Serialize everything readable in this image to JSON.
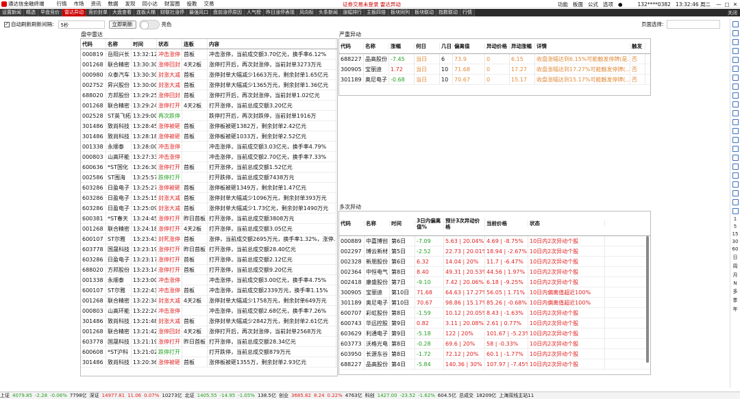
{
  "titlebar": {
    "app": "通达信金融终端",
    "menu": [
      "行情",
      "市场",
      "资讯",
      "数据",
      "发现",
      "同小达",
      "财富圈",
      "投教",
      "交易"
    ],
    "center": "证券交易未登录  雷达异动",
    "right": [
      "功能",
      "板面",
      "公式",
      "选项"
    ],
    "account": "132****0382",
    "time": "13:32:46 周二"
  },
  "tabs": [
    {
      "label": "设置新闻"
    },
    {
      "label": "精选"
    },
    {
      "label": "早盘竞价"
    },
    {
      "label": "雷达异动",
      "active": true
    },
    {
      "label": "竞价封单"
    },
    {
      "label": "大盘查看"
    },
    {
      "label": "连板天梯"
    },
    {
      "label": "财联社涨停"
    },
    {
      "label": "最强风口"
    },
    {
      "label": "盘前涨停原因"
    },
    {
      "label": "人气榜"
    },
    {
      "label": "昨日涨停表现"
    },
    {
      "label": "风向标"
    },
    {
      "label": "头条新闻"
    },
    {
      "label": "涨幅排行"
    },
    {
      "label": "主板四倍"
    },
    {
      "label": "板块同列"
    },
    {
      "label": "板块联动"
    },
    {
      "label": "指数联动"
    },
    {
      "label": "行情"
    }
  ],
  "tab_close": "关闭",
  "controls": {
    "auto_refresh_label": "自动刷新刷新间隔:",
    "interval": "5秒",
    "refresh_button": "立即刷新",
    "bright_label": "亮色",
    "page_select_label": "页面选择:"
  },
  "radar": {
    "title": "盘中雷达",
    "headers": [
      "代码",
      "名称",
      "时间",
      "状态",
      "连板",
      "内容"
    ],
    "rows": [
      [
        "000819",
        "岳阳兴长",
        "13:32:12",
        "冲击涨停",
        "首板",
        "冲击涨停，当前成交额3.70亿元，换手率6.12%"
      ],
      [
        "001268",
        "联合精密",
        "13:30:30",
        "涨停回封",
        "4天2板",
        "涨停打开后，再次封涨停，当前封单3273万元"
      ],
      [
        "000980",
        "众泰汽车",
        "13:30:30",
        "封涨大减",
        "首板",
        "涨停封单大幅减少1663万元，剩余封单1.65亿元"
      ],
      [
        "002752",
        "昇兴股份",
        "13:30:00",
        "封涨大减",
        "首板",
        "涨停封单大幅减少1365万元，剩余封单1.36亿元"
      ],
      [
        "688020",
        "方邦股份",
        "13:29:25",
        "涨停回封",
        "首板",
        "涨停打开后，再次封涨停，当前封单1.02亿元"
      ],
      [
        "001268",
        "联合精密",
        "13:29:24",
        "涨停打开",
        "4天2板",
        "打开涨停，当前总成交额3.20亿元"
      ],
      [
        "002528",
        "ST英飞拓",
        "13:29:00",
        "再次跌停",
        "",
        "跌停打开后，再次封跌停，当前封单1916万"
      ],
      [
        "301486",
        "致尚科技",
        "13:28:45",
        "涨停被砸",
        "首板",
        "涨停板被砸1382万，剩余封单2.42亿元"
      ],
      [
        "301486",
        "致尚科技",
        "13:28:18",
        "涨停被砸",
        "首板",
        "涨停板被砸1033万，剩余封单2.52亿元"
      ],
      [
        "001338",
        "永顺泰",
        "13:28:00",
        "冲击涨停",
        "",
        "冲击涨停，当前成交额3.03亿元，换手率4.79%"
      ],
      [
        "000803",
        "山高环能",
        "13:27:33",
        "冲击涨停",
        "",
        "冲击涨停，当前成交额2.70亿元，换手率7.33%"
      ],
      [
        "600636",
        "*ST国化",
        "13:26:30",
        "涨停打开",
        "首板",
        "打开涨停，当前总成交额1.52亿元"
      ],
      [
        "002586",
        "ST围海",
        "13:25:57",
        "跌停打开",
        "",
        "打开跌停，当前总成交额7438万元"
      ],
      [
        "603286",
        "日盈电子",
        "13:25:27",
        "涨停被砸",
        "首板",
        "涨停板被砸1349万，剩余封单1.47亿元"
      ],
      [
        "603286",
        "日盈电子",
        "13:25:15",
        "封涨大减",
        "首板",
        "涨停封单大幅减少1096万元，剩余封单393万元"
      ],
      [
        "603286",
        "日盈电子",
        "13:25:09",
        "封涨大减",
        "首板",
        "涨停封单大幅减少1.73亿元，剩余封单1490万元"
      ],
      [
        "600381",
        "*ST春天",
        "13:24:45",
        "涨停打开",
        "昨日首板",
        "打开涨停，当前总成交额3808万元"
      ],
      [
        "001268",
        "联合精密",
        "13:24:18",
        "涨停打开",
        "4天2板",
        "打开涨停，当前总成交额3.05亿元"
      ],
      [
        "600107",
        "ST尔雅",
        "13:23:43",
        "封死涨停",
        "首板",
        "涨停，当前成交额2695万元，换手率1.32%，涨停..."
      ],
      [
        "603778",
        "国晟科技",
        "13:23:19",
        "涨停打开",
        "昨日首板",
        "打开涨停，当前总成交额28.40亿元"
      ],
      [
        "603286",
        "日盈电子",
        "13:23:17",
        "涨停打开",
        "首板",
        "打开涨停，当前总成交额2.12亿元"
      ],
      [
        "688020",
        "方邦股份",
        "13:23:14",
        "涨停打开",
        "首板",
        "打开涨停，当前总成交额9.20亿元"
      ],
      [
        "001338",
        "永顺泰",
        "13:23:00",
        "冲击涨停",
        "",
        "冲击涨停，当前成交额3.00亿元，换手率4.75%"
      ],
      [
        "600107",
        "ST尔雅",
        "13:22:43",
        "冲击涨停",
        "首板",
        "冲击涨停，当前成交额2339万元，换手率1.15%"
      ],
      [
        "001268",
        "联合精密",
        "13:22:34",
        "封涨大减",
        "4天2板",
        "涨停封单大幅减少1758万元，剩余封单649万元"
      ],
      [
        "000803",
        "山高环能",
        "13:22:24",
        "冲击涨停",
        "",
        "冲击涨停，当前成交额2.68亿元，换手率7.26%"
      ],
      [
        "301486",
        "致尚科技",
        "13:21:48",
        "封涨大减",
        "首板",
        "涨停封单大幅减少2842万元，剩余封单2.61亿元"
      ],
      [
        "001268",
        "联合精密",
        "13:21:42",
        "涨停回封",
        "4天2板",
        "涨停打开后，再次封涨停，当前封单2568万元"
      ],
      [
        "603778",
        "国晟科技",
        "13:21:19",
        "涨停打开",
        "昨日首板",
        "打开涨停，当前总成交额28.34亿元"
      ],
      [
        "600608",
        "*ST沪科",
        "13:21:02",
        "跌停打开",
        "",
        "打开跌停，当前总成交额879万元"
      ],
      [
        "301486",
        "致尚科技",
        "13:20:36",
        "涨停被砸",
        "首板",
        "涨停板被砸1355万，剩余封单2.93亿元"
      ]
    ]
  },
  "severe": {
    "title": "严重异动",
    "headers": [
      "代码",
      "名称",
      "涨幅",
      "何日",
      "几日",
      "偏离值",
      "异动价格",
      "异动涨幅",
      "详情",
      "触发"
    ],
    "rows": [
      [
        "688227",
        "品高股份",
        "-7.45",
        "当日",
        "6",
        "73.9",
        "0",
        "6.15",
        "收盘涨幅达到6.15%可能触发停牌(是...",
        "否"
      ],
      [
        "300905",
        "宝丽迪",
        "1.72",
        "当日",
        "10",
        "71.68",
        "0",
        "17.27",
        "收盘涨幅达到17.27%可能触发停牌(...",
        "否"
      ],
      [
        "301189",
        "奥尼电子",
        "-0.68",
        "当日",
        "10",
        "70.67",
        "0",
        "15.17",
        "收盘涨幅达到15.17%可能触发停牌(...",
        "否"
      ]
    ]
  },
  "multi": {
    "title": "多次异动",
    "headers": [
      "代码",
      "名称",
      "时间",
      "3日内偏离值%",
      "预计3次异动价格",
      "当前价格",
      "状态"
    ],
    "rows": [
      [
        "000889",
        "中嘉博创",
        "第6日",
        "-7.09",
        "5.63 | 20.04%",
        "4.69 | -8.75%",
        "10日内2次异动个股"
      ],
      [
        "002297",
        "博云新材",
        "第5日",
        "-2.52",
        "22.73 | 20.01%",
        "18.94 | -2.67%",
        "10日内2次异动个股"
      ],
      [
        "002328",
        "新朋股份",
        "第6日",
        "6.32",
        "14.04 | 20%",
        "11.7 | -6.47%",
        "10日内2次异动个股"
      ],
      [
        "002364",
        "中恒电气",
        "第8日",
        "8.40",
        "49.31 | 20.53%",
        "44.56 | 1.97%",
        "10日内2次异动个股"
      ],
      [
        "002418",
        "康盛股份",
        "第7日",
        "-9.10",
        "7.42 | 20.06%",
        "6.18 | -9.25%",
        "10日内2次异动个股"
      ],
      [
        "300905",
        "宝丽迪",
        "第10日",
        "71.68",
        "64.63 | 17.27%",
        "56.05 | 1.71%",
        "10日内偏离值超近100%"
      ],
      [
        "301189",
        "奥尼电子",
        "第10日",
        "70.67",
        "98.86 | 15.17%",
        "85.26 | -0.68%",
        "10日内偏离值超近100%"
      ],
      [
        "600707",
        "彩虹股份",
        "第8日",
        "-1.59",
        "10.12 | 20.05%",
        "8.43 | -1.63%",
        "10日内2次异动个股"
      ],
      [
        "600743",
        "华远控股",
        "第9日",
        "0.82",
        "3.11 | 20.08%",
        "2.61 | 0.77%",
        "10日内2次异动个股"
      ],
      [
        "603629",
        "利通电子",
        "第9日",
        "-5.18",
        "122 | 20%",
        "101.67 | -5.23%",
        "10日内2次异动个股"
      ],
      [
        "603773",
        "沃格光电",
        "第8日",
        "-0.28",
        "69.6 | 20%",
        "58 | -0.33%",
        "10日内2次异动个股"
      ],
      [
        "603950",
        "长源东谷",
        "第8日",
        "-1.72",
        "72.12 | 20%",
        "60.1 | -1.77%",
        "10日内2次异动个股"
      ],
      [
        "688227",
        "品高股份",
        "第4日",
        "-5.84",
        "140.36 | 30%",
        "107.97 | -7.45%",
        "10日内2次异动个股"
      ]
    ]
  },
  "sidebar_chars": [
    "1",
    "5",
    "15",
    "30",
    "60",
    "日",
    "周",
    "月",
    "N",
    "多",
    "季",
    "年"
  ],
  "status": [
    {
      "name": "上证",
      "value": "4079.85",
      "chg": "-2.28",
      "pct": "-0.06%",
      "vol": "7798亿",
      "color": "green"
    },
    {
      "name": "深证",
      "value": "14977.81",
      "chg": "11.06",
      "pct": "0.07%",
      "vol": "10273亿",
      "color": "red"
    },
    {
      "name": "北证",
      "value": "1405.55",
      "chg": "-14.95",
      "pct": "-1.05%",
      "vol": "138.5亿",
      "color": "green"
    },
    {
      "name": "创业",
      "value": "3685.82",
      "chg": "8.24",
      "pct": "0.22%",
      "vol": "4763亿",
      "color": "red"
    },
    {
      "name": "科创",
      "value": "1427.00",
      "chg": "-23.52",
      "pct": "-1.62%",
      "vol": "604.5亿",
      "color": "green"
    }
  ],
  "status_extra": [
    "总成交",
    "18209亿",
    "上海双线主站11"
  ]
}
